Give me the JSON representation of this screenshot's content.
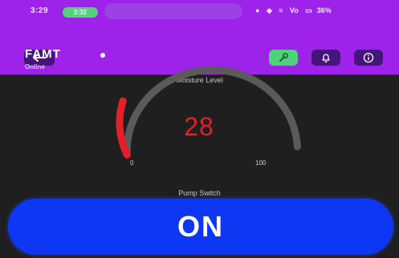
{
  "status_bar": {
    "time": "3:29",
    "call_pill": "2:32",
    "signal_text": "Vo",
    "battery": "36%"
  },
  "app_bar": {
    "title": "FAMT",
    "subtitle": "Online",
    "tool_button_color": "#4fd37a",
    "back_icon": "back-arrow-icon",
    "tool_icon": "wrench-icon",
    "bell_icon": "bell-icon",
    "info_icon": "info-icon"
  },
  "moisture": {
    "label": "Moisture Level",
    "value": "28",
    "min": "0",
    "max": "100",
    "level_color": "#e3202a",
    "track_color": "#5a5a5a"
  },
  "pump": {
    "label": "Pump Switch",
    "state": "ON",
    "color": "#0d37f2"
  },
  "colors": {
    "header": "#9d22ea",
    "background": "#1f1f1f"
  }
}
